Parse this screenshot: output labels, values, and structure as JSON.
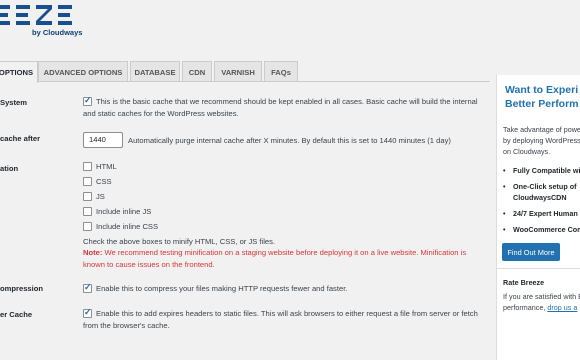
{
  "brand": {
    "logo_text": "EEZE",
    "tagline": "by Cloudways",
    "color": "#1a4f8f"
  },
  "tabs": [
    {
      "label": "OPTIONS",
      "active": true
    },
    {
      "label": "ADVANCED OPTIONS",
      "active": false
    },
    {
      "label": "DATABASE",
      "active": false
    },
    {
      "label": "CDN",
      "active": false
    },
    {
      "label": "VARNISH",
      "active": false
    },
    {
      "label": "FAQs",
      "active": false
    }
  ],
  "settings": {
    "cache_system": {
      "label": "System",
      "checked": true,
      "desc_line1": "This is the basic cache that we recommend should be kept enabled in all cases. Basic cache will build the internal",
      "desc_line2": "and static caches for the WordPress websites."
    },
    "purge": {
      "label": "cache after",
      "value": "1440",
      "desc": "Automatically purge internal cache after X minutes. By default this is set to 1440 minutes (1 day)"
    },
    "minification": {
      "label": "ation",
      "options": [
        {
          "label": "HTML",
          "checked": false
        },
        {
          "label": "CSS",
          "checked": false
        },
        {
          "label": "JS",
          "checked": false
        },
        {
          "label": "Include inline JS",
          "checked": false
        },
        {
          "label": "Include inline CSS",
          "checked": false
        }
      ],
      "help": "Check the above boxes to minify HTML, CSS, or JS files.",
      "note_label": "Note:",
      "note_line1": "We recommend testing minification on a staging website before deploying it on a live website. Minification is",
      "note_line2": "known to cause issues on the frontend."
    },
    "gzip": {
      "label": "ompression",
      "checked": true,
      "desc": "Enable this to compress your files making HTTP requests fewer and faster."
    },
    "browser_cache": {
      "label": "er Cache",
      "checked": true,
      "desc_line1": "Enable this to add expires headers to static files. This will ask browsers to either request a file from server or fetch",
      "desc_line2": "from the browser's cache."
    }
  },
  "sidebar": {
    "heading_line1": "Want to Experi",
    "heading_line2": "Better Perform",
    "intro_line1": "Take advantage of powe",
    "intro_line2": "by deploying WordPress",
    "intro_line3": "on Cloudways.",
    "bullets": [
      {
        "line1": "Fully Compatible wi",
        "line2": ""
      },
      {
        "line1": "One-Click setup of",
        "line2": "CloudwaysCDN"
      },
      {
        "line1": "24/7 Expert Human",
        "line2": ""
      },
      {
        "line1": "WooCommerce Com",
        "line2": ""
      }
    ],
    "button_label": "Find Out More",
    "rate_heading": "Rate Breeze",
    "rate_line1": "If you are satisfied with B",
    "rate_line2_text": "performance, ",
    "rate_link": "drop us a"
  }
}
